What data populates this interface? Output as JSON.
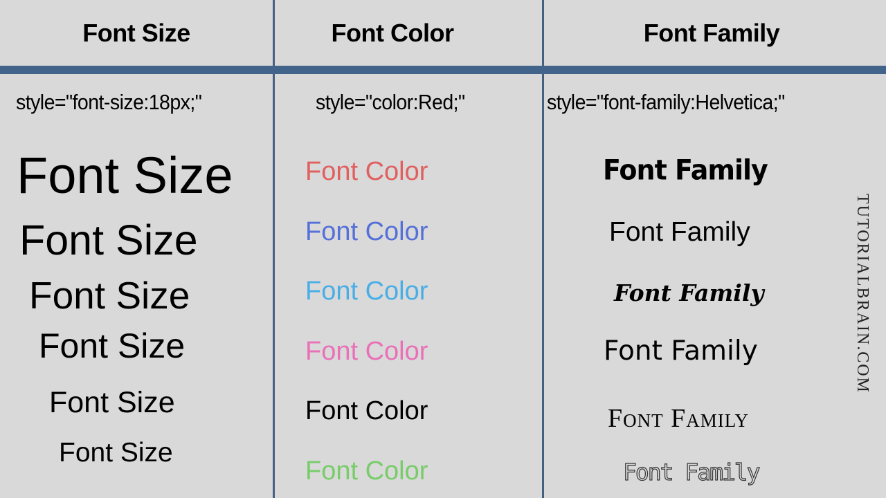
{
  "headers": {
    "font_size": "Font Size",
    "font_color": "Font Color",
    "font_family": "Font Family"
  },
  "code_examples": {
    "font_size": "style=\"font-size:18px;\"",
    "font_color": "style=\"color:Red;\"",
    "font_family": "style=\"font-family:Helvetica;\""
  },
  "font_size_samples": [
    {
      "text": "Font Size"
    },
    {
      "text": "Font Size"
    },
    {
      "text": "Font Size"
    },
    {
      "text": "Font Size"
    },
    {
      "text": "Font Size"
    },
    {
      "text": "Font Size"
    }
  ],
  "font_color_samples": [
    {
      "text": "Font Color",
      "color": "#e06060"
    },
    {
      "text": "Font Color",
      "color": "#5570d8"
    },
    {
      "text": "Font Color",
      "color": "#4aaee6"
    },
    {
      "text": "Font Color",
      "color": "#ea70b8"
    },
    {
      "text": "Font Color",
      "color": "#000000"
    },
    {
      "text": "Font Color",
      "color": "#78cc6a"
    }
  ],
  "font_family_samples": [
    {
      "text": "Font Family",
      "style": "heavy-display"
    },
    {
      "text": "Font Family",
      "style": "sans"
    },
    {
      "text": "Font Family",
      "style": "blackletter"
    },
    {
      "text": "Font Family",
      "style": "geometric-sans"
    },
    {
      "text": "Font Family",
      "style": "small-caps-serif"
    },
    {
      "text": "Font Family",
      "style": "outline-pixel"
    }
  ],
  "watermark": "TUTORIALBRAIN.COM",
  "colors": {
    "background": "#d9d9d9",
    "divider": "#42648a"
  }
}
